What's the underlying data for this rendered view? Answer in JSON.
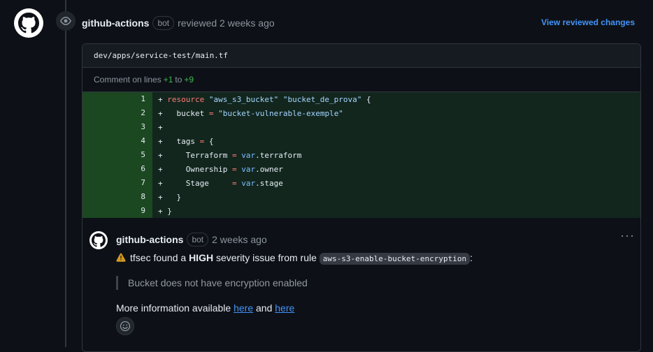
{
  "review": {
    "author": "github-actions",
    "bot_label": "bot",
    "action_text": "reviewed 2 weeks ago",
    "view_link": "View reviewed changes"
  },
  "file": {
    "path": "dev/apps/service-test/main.tf",
    "comment_on_lines_prefix": "Comment on lines",
    "line_start": "+1",
    "to_word": "to",
    "line_end": "+9"
  },
  "code_lines": [
    {
      "num": "1"
    },
    {
      "num": "2"
    },
    {
      "num": "3"
    },
    {
      "num": "4"
    },
    {
      "num": "5"
    },
    {
      "num": "6"
    },
    {
      "num": "7"
    },
    {
      "num": "8"
    },
    {
      "num": "9"
    }
  ],
  "code_text": {
    "l1_resource": "resource",
    "l1_type": "\"aws_s3_bucket\"",
    "l1_name": "\"bucket_de_prova\"",
    "l2_key": "bucket",
    "l2_val": "\"bucket-vulnerable-exemple\"",
    "l4_key": "tags",
    "l5_key": "Terraform",
    "l5_var": "var",
    "l5_attr": ".terraform",
    "l6_key": "Ownership",
    "l6_var": "var",
    "l6_attr": ".owner",
    "l7_key": "Stage",
    "l7_var": "var",
    "l7_attr": ".stage"
  },
  "comment": {
    "author": "github-actions",
    "bot_label": "bot",
    "time": "2 weeks ago",
    "more_label": "···",
    "line1_prefix": "tfsec found a",
    "severity": "HIGH",
    "line1_mid": "severity issue from rule",
    "rule": "aws-s3-enable-bucket-encryption",
    "line1_suffix": ":",
    "quote": "Bucket does not have encryption enabled",
    "more_info_prefix": "More information available",
    "link1": "here",
    "and_word": "and",
    "link2": "here"
  },
  "colors": {
    "accent": "#4493f8",
    "added_bg": "#12261e",
    "added_num_bg": "#1b4721",
    "warning": "#d29922"
  }
}
